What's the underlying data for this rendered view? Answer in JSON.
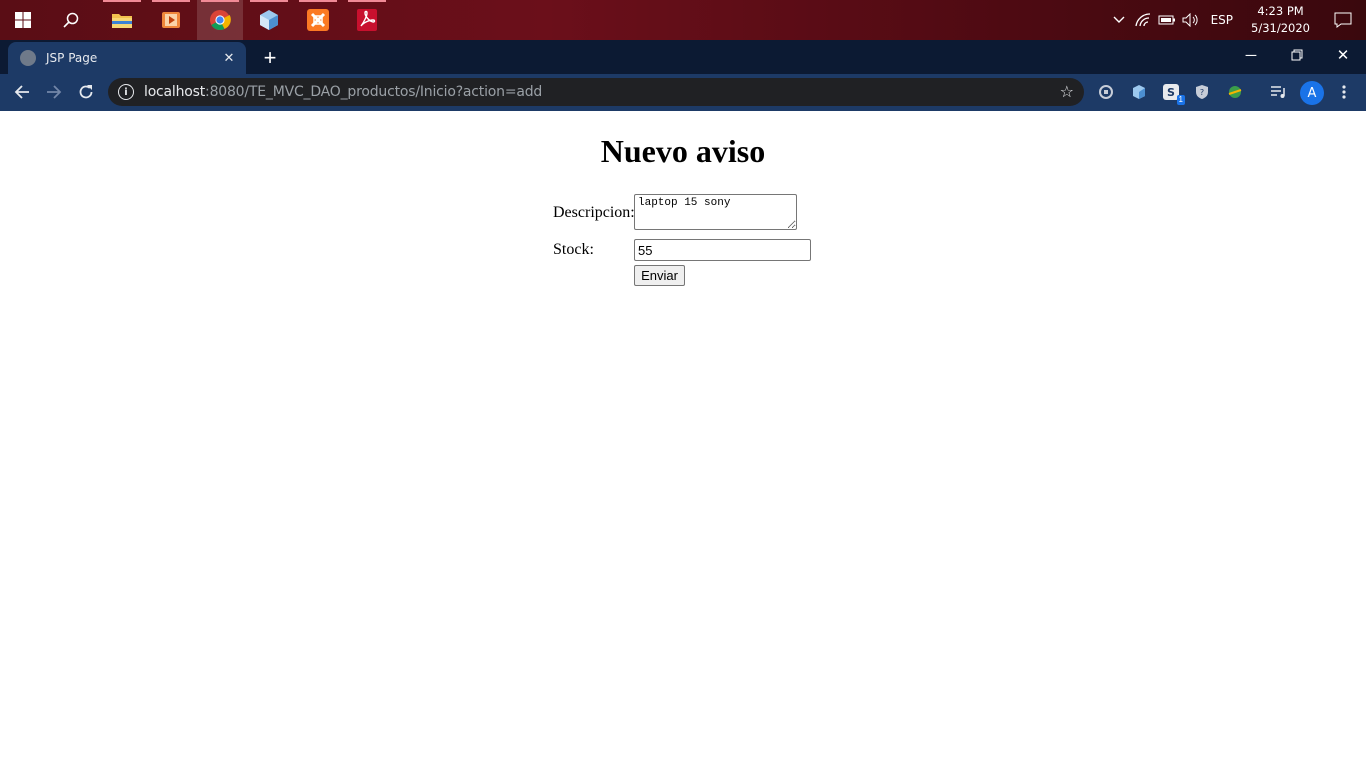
{
  "taskbar": {
    "start_icon": "windows-start-icon",
    "search_icon": "search-icon",
    "apps": [
      {
        "name": "file-explorer-icon",
        "glyph": "📁"
      },
      {
        "name": "media-player-icon",
        "glyph": "▶"
      },
      {
        "name": "chrome-icon",
        "glyph": "◉"
      },
      {
        "name": "virtualbox-icon",
        "glyph": "⬢"
      },
      {
        "name": "xampp-icon",
        "glyph": "✖"
      },
      {
        "name": "acrobat-icon",
        "glyph": "Ⓐ"
      }
    ],
    "language": "ESP",
    "time": "4:23 PM",
    "date": "5/31/2020"
  },
  "browser": {
    "tab_title": "JSP Page",
    "url_host": "localhost",
    "url_path": ":8080/TE_MVC_DAO_productos/Inicio?action=add",
    "profile_initial": "A",
    "extension_badge": "1"
  },
  "page": {
    "heading": "Nuevo aviso",
    "descripcion_label": "Descripcion:",
    "descripcion_value": "laptop 15 sony",
    "stock_label": "Stock:",
    "stock_value": "55",
    "submit_label": "Enviar"
  }
}
